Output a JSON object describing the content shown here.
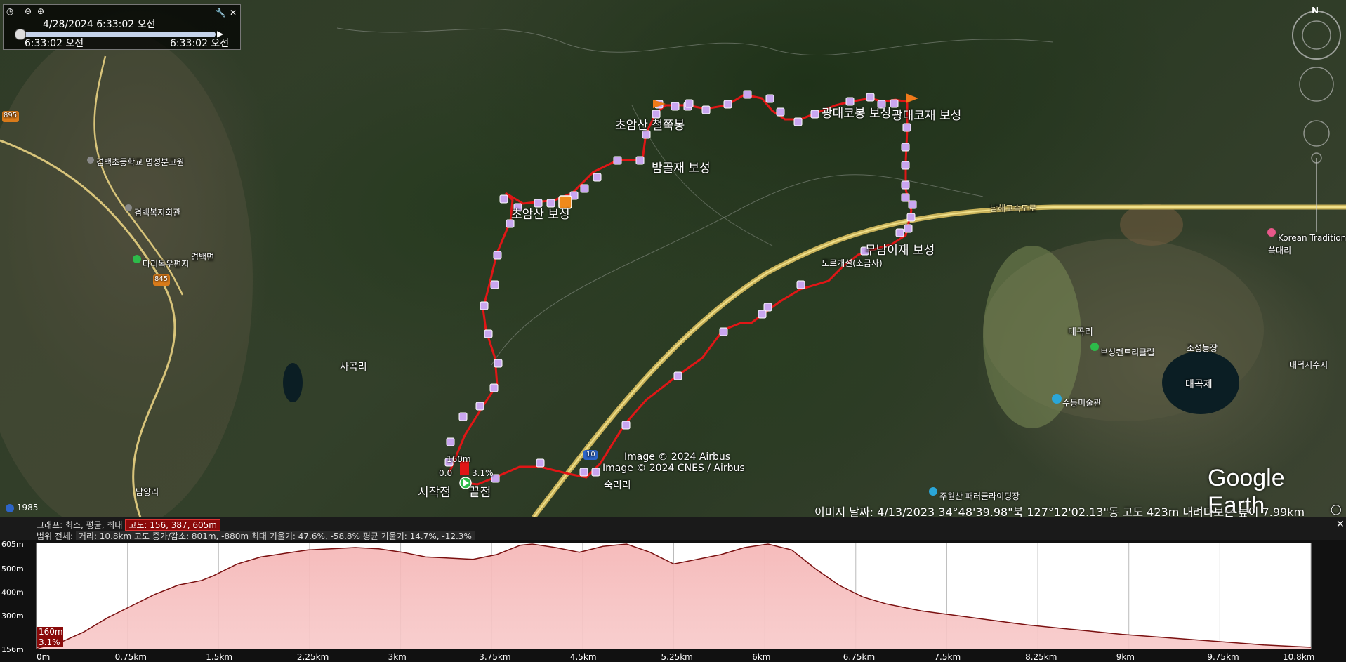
{
  "timebox": {
    "date_time": "4/28/2024    6:33:02 오전",
    "start_time": "6:33:02 오전",
    "end_time": "6:33:02 오전"
  },
  "map_labels": {
    "peak1": "초암산 철쭉봉",
    "bamgol": "밤골재 보성",
    "choamsan": "초암산 보성",
    "gwangdae_peak": "광대코봉 보성",
    "gwangdae_pass": "광대코재 보성",
    "mugami": "무남이재 보성",
    "start": "시작점",
    "end": "끝점",
    "sagokri": "사곡리",
    "sukri": "숙리리",
    "gyeongbaek_school": "겸백초등학교 명성분교원",
    "gyeongbaek_hall": "겸백복지회관",
    "gyeongbaekmyeon": "겸백면",
    "post": "다리목우편지",
    "daegokri": "대곡리",
    "daegokje": "대곡제",
    "golf": "보성컨트리클럽",
    "art": "수동미술관",
    "paragliding": "주원산 패러글라이딩장",
    "right_reservoir": "대덕저수지",
    "korean": "Korean Tradition",
    "hwangdae": "쑥대리",
    "highway": "남해고속도로",
    "nam": "남양리",
    "jochang": "조성농장",
    "road895": "895",
    "road845": "845",
    "road10": "10",
    "sign160": "160m",
    "pct": "3.1%",
    "pct0": "0.0",
    "facility": "도로개설(소금사)"
  },
  "copyright": [
    "Image © 2024 Airbus",
    "Image © 2024 CNES / Airbus"
  ],
  "logo": "Google Earth",
  "status_bar": "이미지 날짜: 4/13/2023    34°48'39.98\"북  127°12'02.13\"동  고도  423m    내려다보는 높이  7.99km",
  "year": "1985",
  "compass_n": "N",
  "graph_header": {
    "line1_prefix": "그래프: 최소, 평균, 최대",
    "line1_value": "고도: 156, 387, 605m",
    "line2_prefix": "범위 전체:",
    "line2_value": "거리: 10.8km 고도 증가/감소: 801m, -880m 최대 기울기: 47.6%, -58.8% 평균 기울기: 14.7%, -12.3%"
  },
  "chart_data": {
    "type": "area",
    "title": "",
    "xlabel": "",
    "ylabel": "",
    "x_unit": "km",
    "x_ticks": [
      "0m",
      "0.75km",
      "1.5km",
      "2.25km",
      "3km",
      "3.75km",
      "4.5km",
      "5.25km",
      "6km",
      "6.75km",
      "7.5km",
      "8.25km",
      "9km",
      "9.75km",
      "10.8km"
    ],
    "y_ticks": [
      "156m",
      "300m",
      "400m",
      "500m",
      "605m"
    ],
    "ylim": [
      156,
      605
    ],
    "xlim": [
      0,
      10.8
    ],
    "series": [
      {
        "x": [
          0,
          0.2,
          0.4,
          0.6,
          0.8,
          1.0,
          1.2,
          1.4,
          1.5,
          1.7,
          1.9,
          2.1,
          2.3,
          2.5,
          2.7,
          2.9,
          3.1,
          3.3,
          3.5,
          3.7,
          3.9,
          4.1,
          4.2,
          4.4,
          4.6,
          4.8,
          5.0,
          5.2,
          5.4,
          5.6,
          5.8,
          6.0,
          6.2,
          6.4,
          6.6,
          6.8,
          7.0,
          7.2,
          7.5,
          7.8,
          8.1,
          8.4,
          8.8,
          9.2,
          9.6,
          10.0,
          10.4,
          10.8
        ],
        "y": [
          160,
          185,
          230,
          290,
          340,
          390,
          430,
          450,
          470,
          520,
          550,
          565,
          580,
          585,
          590,
          585,
          570,
          550,
          545,
          540,
          560,
          600,
          605,
          590,
          570,
          595,
          605,
          570,
          520,
          540,
          560,
          590,
          605,
          580,
          500,
          430,
          380,
          350,
          320,
          300,
          280,
          260,
          240,
          220,
          205,
          190,
          175,
          165
        ]
      }
    ],
    "cursor": {
      "label_elev": "160m",
      "label_slope": "3.1%"
    },
    "grid": true
  }
}
